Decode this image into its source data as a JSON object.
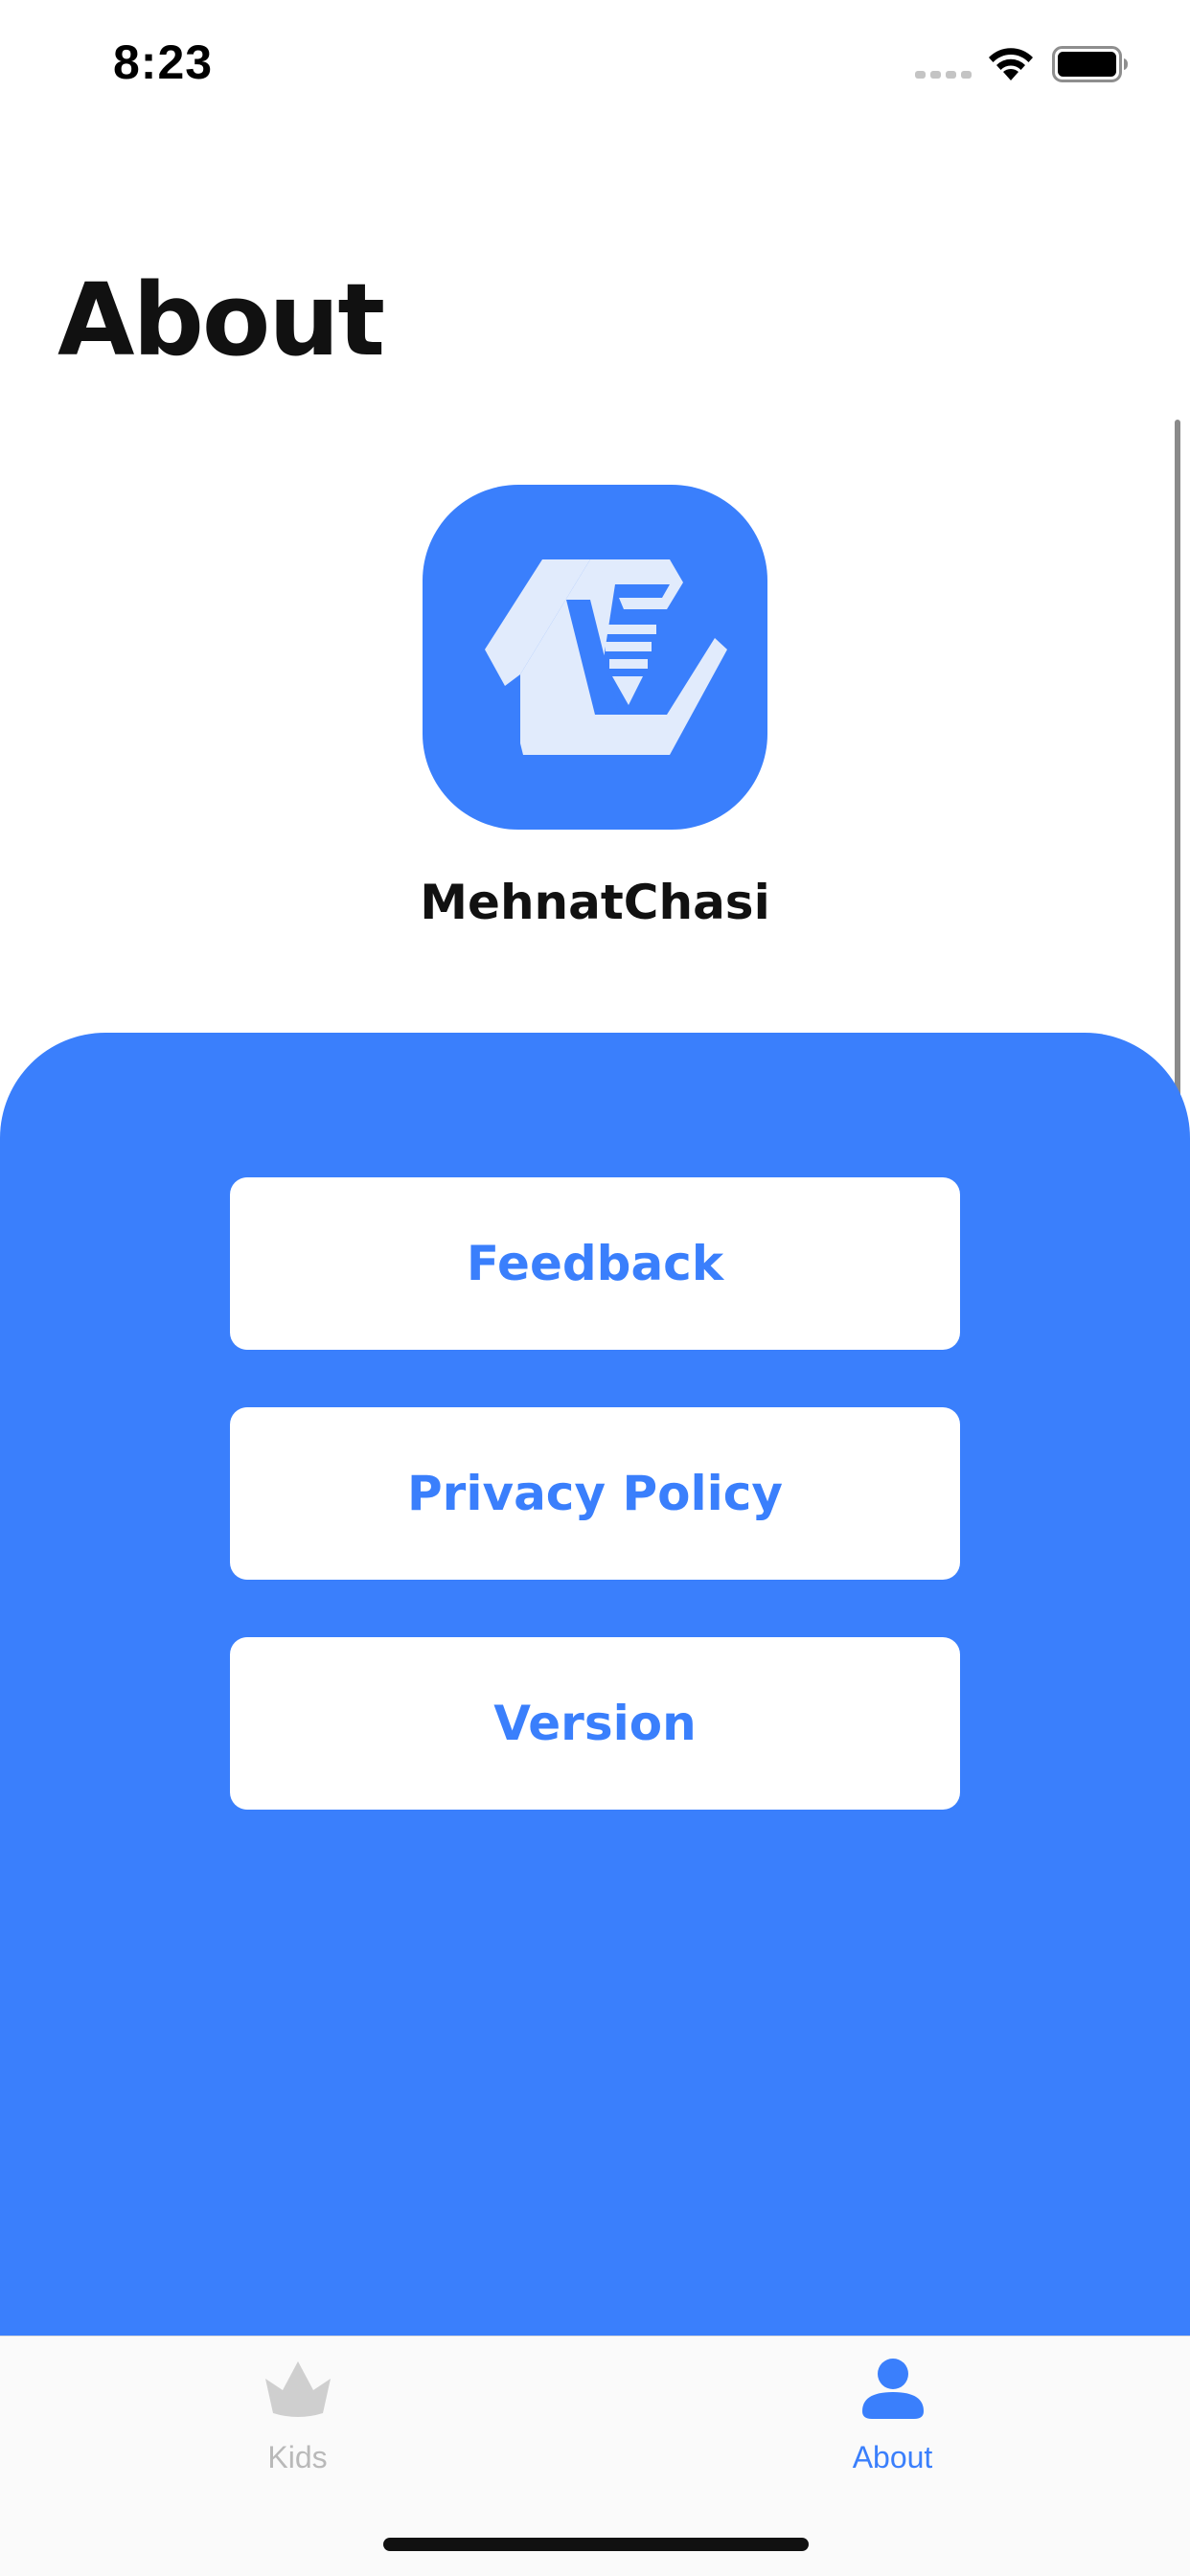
{
  "status_bar": {
    "time": "8:23"
  },
  "header": {
    "title": "About"
  },
  "app": {
    "name": "MehnatChasi",
    "logo_icon": "mehnatchasi-logo",
    "brand_color": "#3a7ffc"
  },
  "menu": {
    "feedback_label": "Feedback",
    "privacy_label": "Privacy Policy",
    "version_label": "Version"
  },
  "tab_bar": {
    "items": [
      {
        "label": "Kids",
        "icon": "crown-icon",
        "selected": false,
        "color": "#b9b9b9"
      },
      {
        "label": "About",
        "icon": "person-icon",
        "selected": true,
        "color": "#3a7ffc"
      }
    ]
  }
}
